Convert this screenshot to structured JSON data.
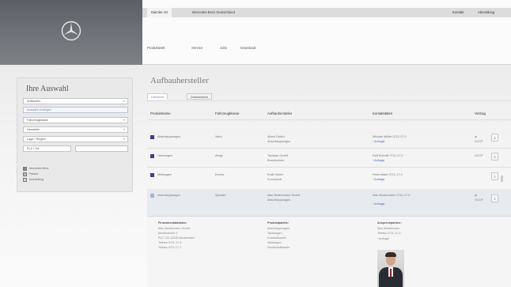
{
  "header": {
    "top_tabs": [
      {
        "label": "Daimler AG",
        "active": true
      },
      {
        "label": "Mercedes-Benz Deutschland",
        "active": false
      }
    ],
    "top_links": [
      "Kontakt",
      "Abmeldung"
    ],
    "main_nav": [
      "Produktwelt",
      "Service",
      "Jobs",
      "Download"
    ]
  },
  "sidebar": {
    "title": "Ihre Auswahl",
    "selects": [
      {
        "label": "Aufbauten",
        "highlight": false
      },
      {
        "label": "Auswahl anzeigen",
        "highlight": true
      },
      {
        "label": "Fahrzeugklasse",
        "highlight": false
      },
      {
        "label": "Hersteller",
        "highlight": false
      },
      {
        "label": "Lage / Region",
        "highlight": false
      }
    ],
    "plz_label": "PLZ / Ort",
    "legend": [
      "Mercedes-Benz",
      "Partner",
      "Ausstellung"
    ]
  },
  "content": {
    "page_title": "Aufbauhersteller",
    "tabs": [
      {
        "label": "Übersicht",
        "active": true
      },
      {
        "label": "Detailansicht",
        "active": false
      }
    ],
    "table": {
      "headers": [
        "Produktname",
        "Fahrzeugklasse",
        "Aufbauhersteller",
        "Kontaktdaten",
        "Vertrag"
      ],
      "rows": [
        {
          "product": "Abschleppwagen",
          "klasse": "Vario",
          "hersteller": [
            "Albert GmbH",
            "Abschleppwagen"
          ],
          "kontakt": [
            "Michael Müller 0711-17-0",
            "Anfrage"
          ],
          "vertrag": [
            "ja",
            "VCCP"
          ],
          "selected": false
        },
        {
          "product": "Tankwagen",
          "klasse": "Atego",
          "hersteller": [
            "Tankbau GmbH",
            "Brandschutz"
          ],
          "kontakt": [
            "Ralf Schmitt 0711-17-0",
            "Anfrage"
          ],
          "vertrag": [
            "VCCP"
          ],
          "selected": false
        },
        {
          "product": "Müllwagen",
          "klasse": "Econic",
          "hersteller": [
            "Kraft GmbH",
            "Kommunal"
          ],
          "kontakt": [
            "Peter Maier 0711-17-0",
            "Anfrage"
          ],
          "vertrag": [],
          "selected": false
        },
        {
          "product": "Abschleppwagen",
          "klasse": "Sprinter",
          "hersteller": [
            "Max Mustermann GmbH",
            "Abschleppwagen"
          ],
          "kontakt": [
            "Max Mustermann 0711-17-0",
            "Anfrage"
          ],
          "vertrag": [
            "ja",
            "VCCP"
          ],
          "selected": true
        }
      ]
    },
    "details": {
      "firma_heading": "Firmenkontaktdaten:",
      "firma_lines": [
        "Max Mustermann GmbH",
        "Musterstraße 1",
        "PLZ, Ort 12345 Musterstadt",
        "Telefon 0711-17-0",
        "Telefax 0711-17-1"
      ],
      "produkt_heading": "Produktpalette:",
      "produkt_lines": [
        "Abschleppwagen",
        "Tankwagen",
        "Kranaufbauten",
        "Müllwagen",
        "Sonderaufbauten"
      ],
      "ansprech_heading": "Ansprechpartner:",
      "ansprech_lines": [
        "Max Mustermann",
        "Telefon 0711-17-0"
      ],
      "ansprech_link": "Anfrage"
    }
  }
}
